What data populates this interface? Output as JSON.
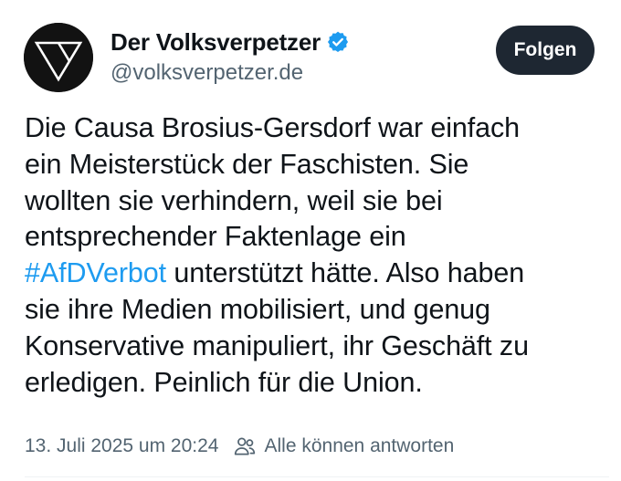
{
  "author": {
    "display_name": "Der Volksverpetzer",
    "handle": "@volksverpetzer.de",
    "verified_icon": "verified-badge-icon"
  },
  "follow_button": {
    "label": "Folgen"
  },
  "post": {
    "lines": [
      "Die Causa Brosius-Gersdorf war einfach",
      "ein Meisterstück der Faschisten. Sie",
      "wollten sie verhindern, weil sie bei",
      "entsprechender Faktenlage ein"
    ],
    "hashtag": "#AfDVerbot",
    "hashtag_line_rest": " unterstützt hätte. Also haben",
    "lines_after": [
      "sie ihre Medien mobilisiert, und genug",
      "Konservative manipuliert, ihr Geschäft zu",
      "erledigen. Peinlich für die Union."
    ]
  },
  "meta": {
    "timestamp": "13. Juli 2025 um 20:24",
    "reply_setting_icon": "people-icon",
    "reply_setting": "Alle können antworten"
  },
  "colors": {
    "text": "#0f1419",
    "secondary": "#536471",
    "link": "#1d9bf0",
    "button_bg": "#1e2732",
    "verified": "#1d9bf0"
  }
}
